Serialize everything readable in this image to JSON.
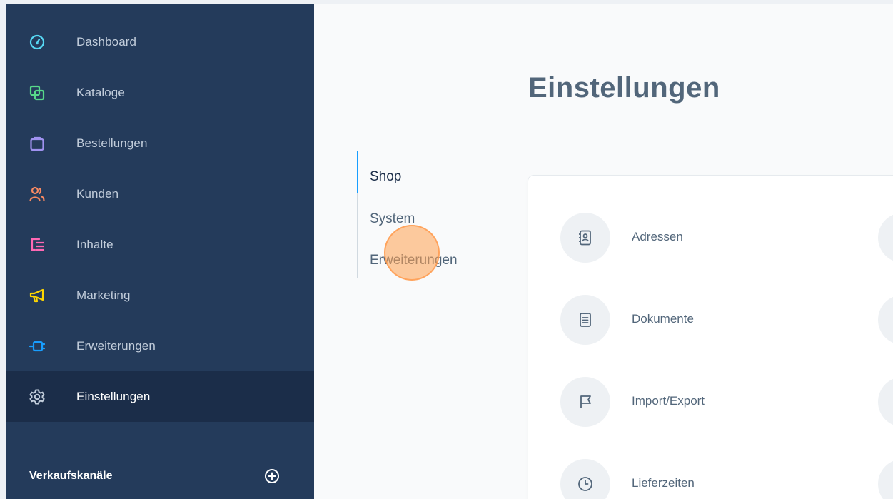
{
  "sidebar": {
    "items": [
      {
        "label": "Dashboard",
        "icon": "dashboard-icon",
        "color": "#57d9f5"
      },
      {
        "label": "Kataloge",
        "icon": "catalog-icon",
        "color": "#57d98a"
      },
      {
        "label": "Bestellungen",
        "icon": "shopping-bag-icon",
        "color": "#a092f0"
      },
      {
        "label": "Kunden",
        "icon": "users-icon",
        "color": "#f88962"
      },
      {
        "label": "Inhalte",
        "icon": "content-icon",
        "color": "#ff68b4"
      },
      {
        "label": "Marketing",
        "icon": "megaphone-icon",
        "color": "#ffd700"
      },
      {
        "label": "Erweiterungen",
        "icon": "plug-icon",
        "color": "#189eff"
      },
      {
        "label": "Einstellungen",
        "icon": "gear-icon",
        "color": "#c2cddb",
        "active": true
      }
    ],
    "channels": {
      "title": "Verkaufskanäle",
      "add_icon": "plus-circle-icon"
    }
  },
  "page": {
    "title": "Einstellungen"
  },
  "subnav": {
    "items": [
      {
        "label": "Shop",
        "active": true
      },
      {
        "label": "System"
      },
      {
        "label": "Erweiterungen"
      }
    ]
  },
  "card": {
    "items": [
      {
        "label": "Adressen",
        "icon": "address-book-icon"
      },
      {
        "label": "Dokumente",
        "icon": "document-icon"
      },
      {
        "label": "Import/Export",
        "icon": "flag-icon"
      },
      {
        "label": "Lieferzeiten",
        "icon": "clock-icon"
      }
    ]
  },
  "colors": {
    "sidebar_bg": "#243b5b",
    "sidebar_active_bg": "#1b2d49",
    "accent": "#189eff",
    "click_highlight": "#ffa050"
  }
}
